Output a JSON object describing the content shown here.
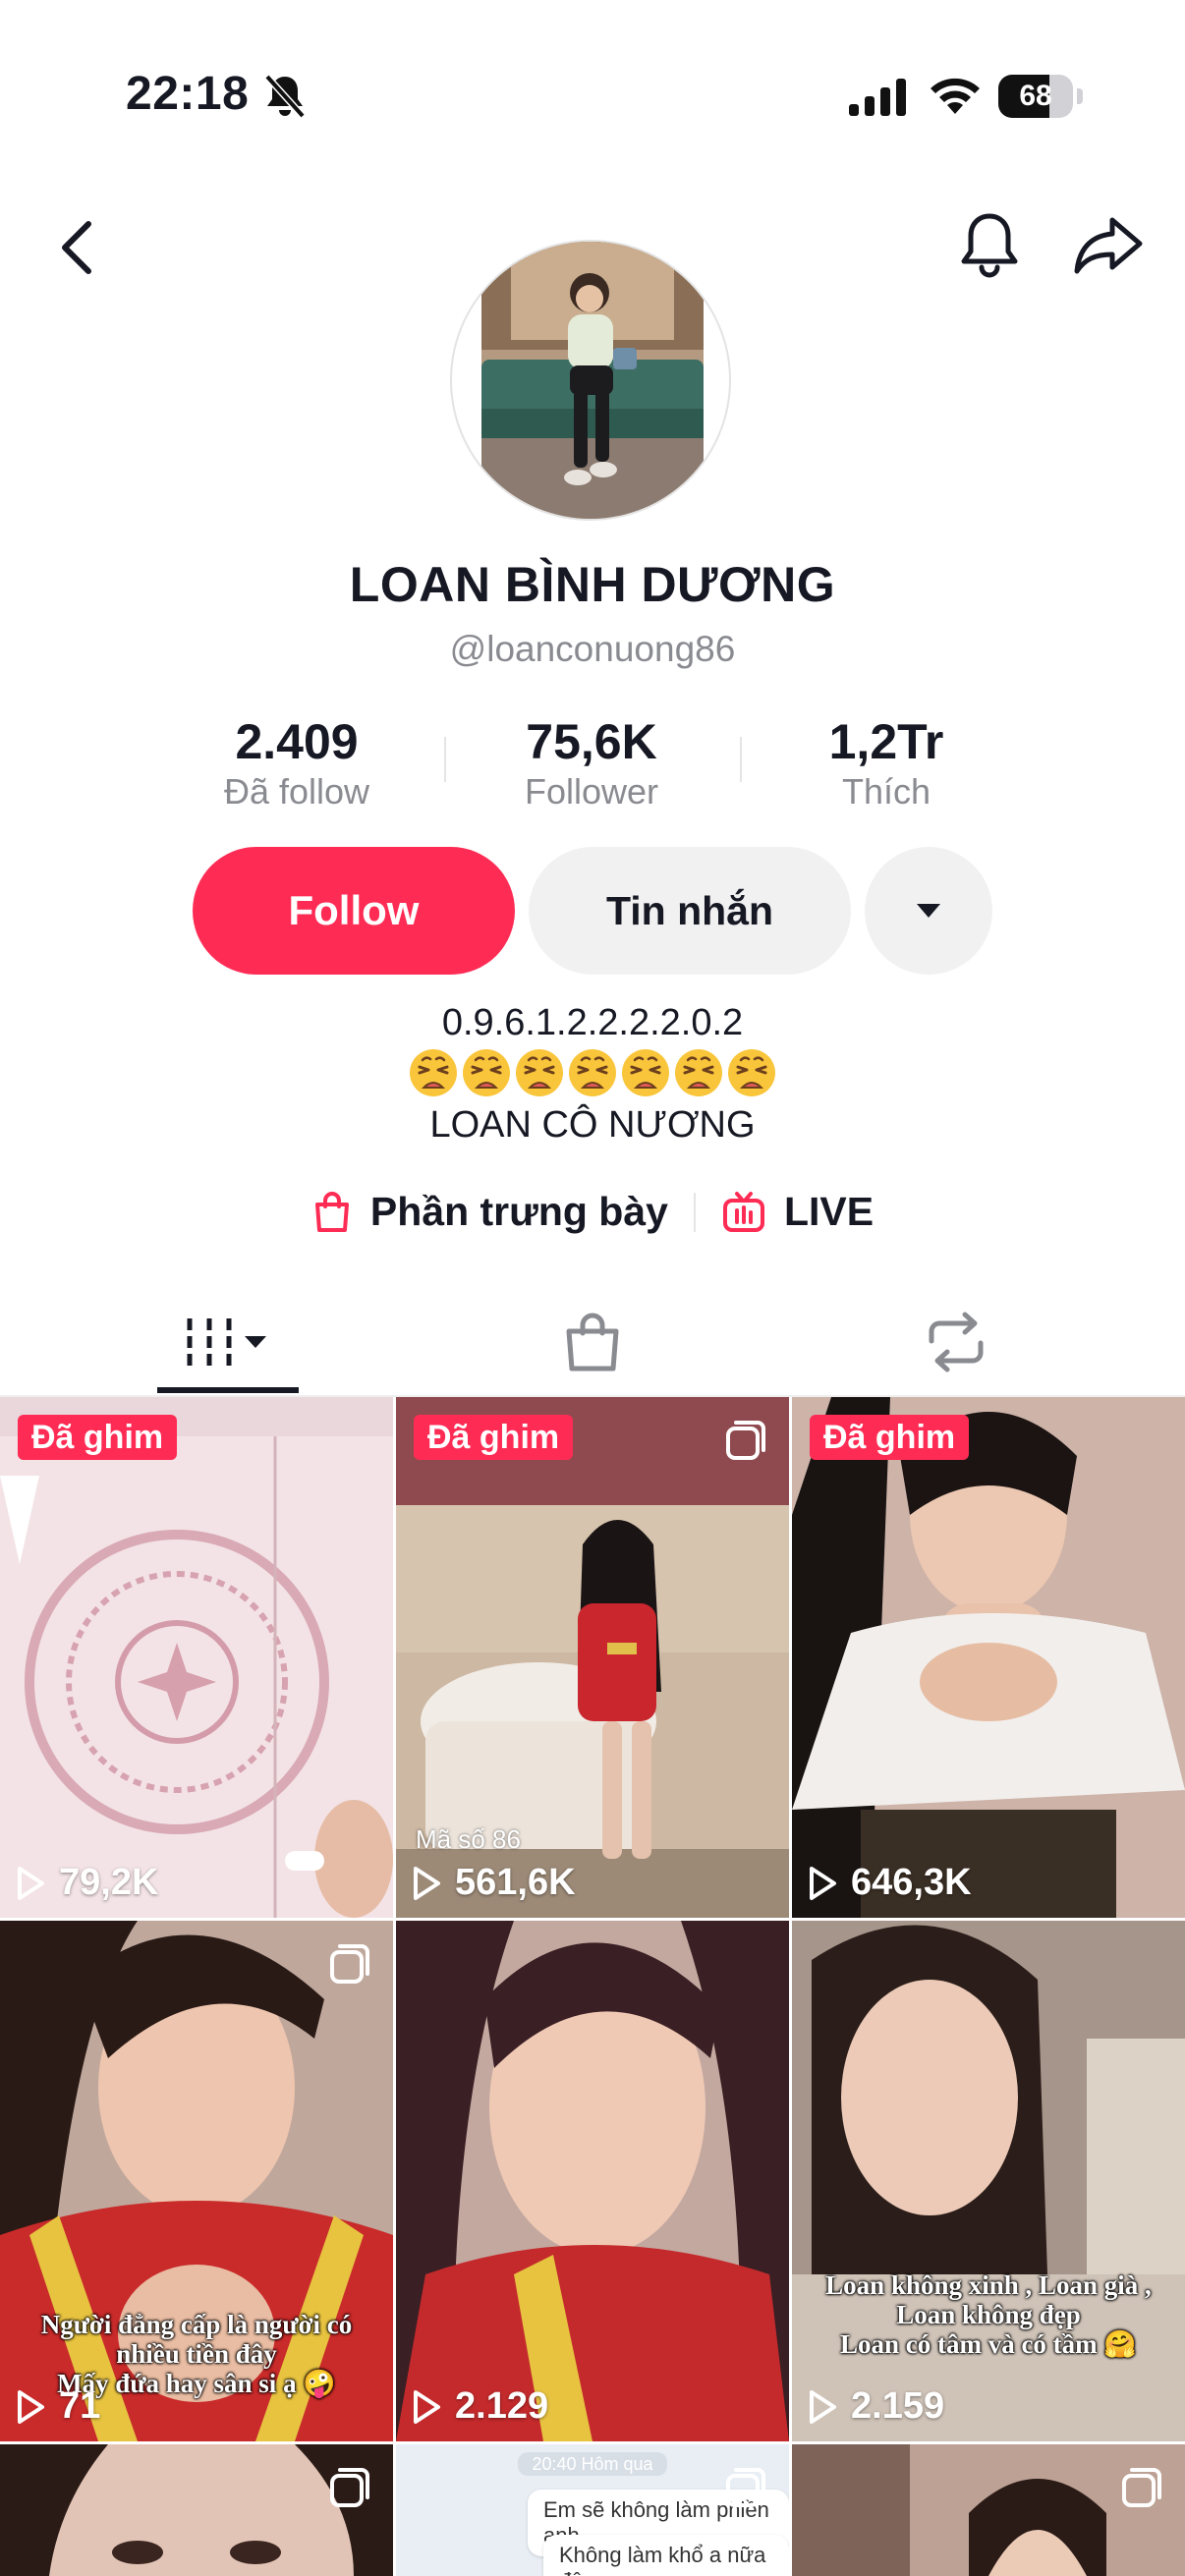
{
  "status_bar": {
    "time": "22:18",
    "battery": "68",
    "battery_level": 0.68
  },
  "profile": {
    "name": "LOAN BÌNH DƯƠNG",
    "handle": "@loanconuong86",
    "stats": [
      {
        "value": "2.409",
        "label": "Đã follow"
      },
      {
        "value": "75,6K",
        "label": "Follower"
      },
      {
        "value": "1,2Tr",
        "label": "Thích"
      }
    ],
    "follow_label": "Follow",
    "message_label": "Tin nhắn",
    "bio_line1": "0.9.6.1.2.2.2.2.0.2",
    "bio_emoji_count": 7,
    "bio_line3": "LOAN CÔ NƯƠNG",
    "showcase_label": "Phần trưng bày",
    "live_label": "LIVE"
  },
  "colors": {
    "accent": "#fe2c55",
    "secondary_button": "#f1f1f2",
    "muted_text": "#8a8b91"
  },
  "tabs": [
    {
      "name": "videos",
      "icon": "grid-bars-icon",
      "active": true
    },
    {
      "name": "shop",
      "icon": "shopping-bag-icon",
      "active": false
    },
    {
      "name": "reposts",
      "icon": "repost-icon",
      "active": false
    }
  ],
  "videos": [
    {
      "pinned": true,
      "pin_label": "Đã ghim",
      "views": "79,2K",
      "multi": false
    },
    {
      "pinned": true,
      "pin_label": "Đã ghim",
      "views": "561,6K",
      "multi": true,
      "label": "Mã số 86"
    },
    {
      "pinned": true,
      "pin_label": "Đã ghim",
      "views": "646,3K",
      "multi": false
    },
    {
      "pinned": false,
      "views": "71",
      "multi": true,
      "caption": [
        "Người đẳng cấp là người có",
        "nhiều tiền đây",
        "Mấy đứa hay sân si ạ 🤪"
      ]
    },
    {
      "pinned": false,
      "views": "2.129",
      "multi": false
    },
    {
      "pinned": false,
      "views": "2.159",
      "multi": false,
      "caption": [
        "Loan không xinh , Loan già ,",
        "Loan không đẹp",
        "Loan có tâm và có tầm 🤗"
      ]
    },
    {
      "pinned": false,
      "views": "",
      "multi": true
    },
    {
      "pinned": false,
      "views": "",
      "multi": true,
      "chat": {
        "time": "20:40 Hôm qua",
        "msg1": "Em sẽ không làm phiền anh",
        "msg2": "Không làm khổ a nữa đâu"
      }
    },
    {
      "pinned": false,
      "views": "",
      "multi": true
    }
  ]
}
